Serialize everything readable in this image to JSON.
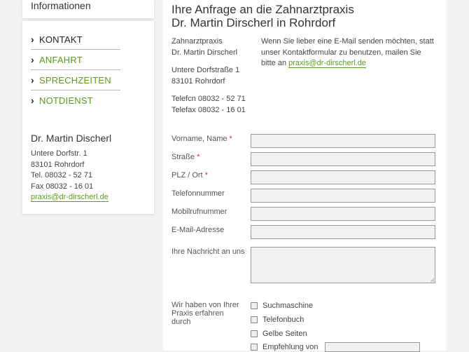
{
  "sidebar": {
    "top_label": "Informationen",
    "nav": [
      {
        "label": "KONTAKT",
        "style": "active"
      },
      {
        "label": "ANFAHRT",
        "style": "green"
      },
      {
        "label": "SPRECHZEITEN",
        "style": "green"
      },
      {
        "label": "NOTDIENST",
        "style": "green"
      }
    ],
    "contact": {
      "name": "Dr. Martin Discherl",
      "street": "Untere Dorfstr. 1",
      "city": "83101 Rohrdorf",
      "tel": "Tel. 08032 - 52 71",
      "fax": "Fax 08032 - 16 01",
      "email": "praxis@dr-dirscherl.de"
    }
  },
  "main": {
    "title_line1": "Ihre Anfrage an die Zahnarztpraxis",
    "title_line2": "Dr. Martin Dirscherl in Rohrdorf",
    "address": {
      "line1": "Zahnarztpraxis",
      "line2": "Dr. Martin Dirscherl",
      "street": "Untere Dorfstraße 1",
      "city": "83101 Rohrdorf",
      "phone": "Telefcn 08032 - 52 71",
      "fax": "Telefax 08032 - 16 01"
    },
    "note": {
      "text": "Wenn Sie lieber eine E-Mail senden möchten, statt unser Kontaktformular zu benutzen, mailen Sie bitte an",
      "email": "praxis@dr-dirscherl.de"
    },
    "form": {
      "fields": [
        {
          "label": "Vorname, Name",
          "required": "*"
        },
        {
          "label": "Straße",
          "required": "*"
        },
        {
          "label": "PLZ / Ort",
          "required": "*"
        },
        {
          "label": "Telefonnummer",
          "required": ""
        },
        {
          "label": "Mobilrufnummer",
          "required": ""
        },
        {
          "label": "E-Mail-Adresse",
          "required": ""
        }
      ],
      "message_label": "Ihre Nachricht an uns",
      "referral_label": "Wir haben von Ihrer Praxis erfahren durch",
      "referral_options": [
        "Suchmaschine",
        "Telefonbuch",
        "Gelbe Seiten",
        "Empfehlung von"
      ]
    }
  },
  "colors": {
    "accent_green": "#5b9a1e",
    "required_red": "#c0392b",
    "page_bg": "#f2f2f2"
  }
}
